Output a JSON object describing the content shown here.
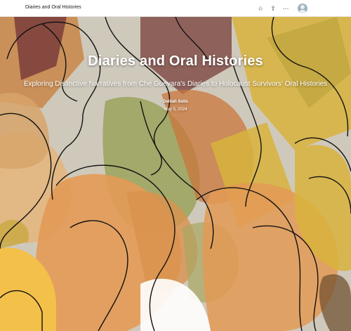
{
  "app": {
    "title": "Diaries and Oral Histories"
  },
  "toolbar": {
    "icons": [
      "star-icon",
      "share-icon",
      "more-icon",
      "user-avatar-icon"
    ],
    "star_glyph": "☆",
    "share_glyph": "⇧",
    "more_glyph": "···"
  },
  "hero": {
    "title": "Diaries and Oral Histories",
    "subtitle": "Exploring Distinctive Narratives from Che Guevara's Diaries to Holocaust Survivors' Oral Histories",
    "author": "Delilah Solis",
    "date": "May 5, 2024"
  },
  "colors": {
    "orange": "#e39a55",
    "dark_orange": "#c9753b",
    "maroon": "#7a3d3b",
    "olive": "#9da561",
    "mustard": "#d8b33c",
    "yellow": "#f3c04a",
    "tan": "#d7a56a",
    "grey": "#bdb9b1"
  }
}
